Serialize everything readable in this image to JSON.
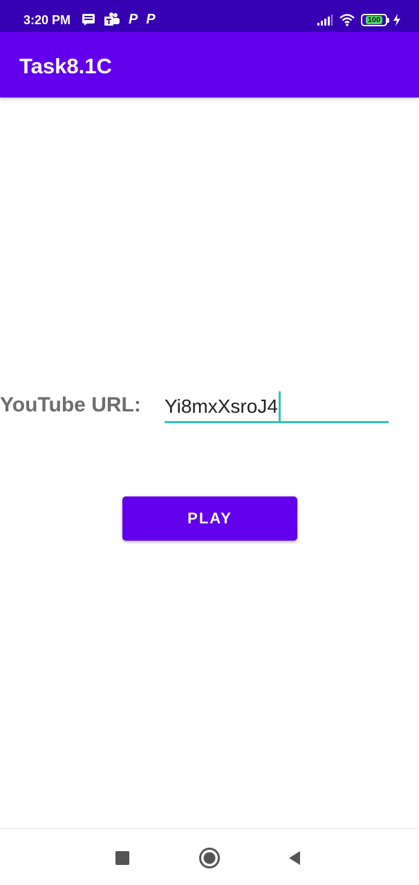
{
  "status_bar": {
    "time": "3:20 PM",
    "notification_icons": [
      "message-icon",
      "teams-icon",
      "p-icon",
      "p-icon"
    ],
    "p_glyph": "P",
    "battery_level": "100",
    "system_icons": [
      "signal-icon",
      "wifi-icon",
      "battery-icon",
      "charging-icon"
    ]
  },
  "app_bar": {
    "title": "Task8.1C"
  },
  "form": {
    "label": "YouTube URL:",
    "url_value": "Yi8mxXsroJ4"
  },
  "play_button": {
    "label": "PLAY"
  },
  "nav_bar": {
    "buttons": [
      "recents-icon",
      "home-icon",
      "back-icon"
    ]
  },
  "colors": {
    "status_bar": "#3700b3",
    "app_bar": "#6200ee",
    "accent": "#2ec4b6",
    "label_text": "#6d6d6d"
  }
}
